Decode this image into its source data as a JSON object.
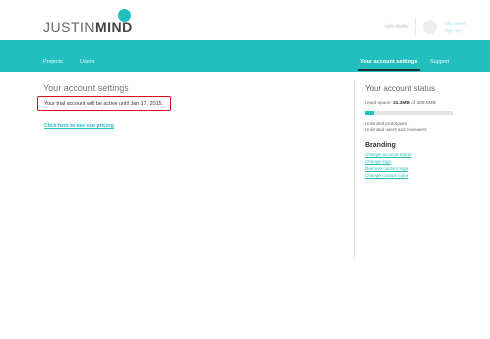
{
  "header": {
    "logo_light": "JUSTIN",
    "logo_bold": "MIND",
    "user_name_blurred": "wilb-studio",
    "user_line1_blurred": "wilb-owner",
    "user_line2_blurred": "Sign out"
  },
  "nav": {
    "projects": "Projects",
    "users": "Users",
    "account_settings": "Your account settings",
    "support": "Support"
  },
  "main": {
    "title": "Your account settings",
    "trial_text": "Your trial account will be active until Jan 17, 2015.",
    "pricing_link": "Click here to see our pricing"
  },
  "sidebar": {
    "status_title": "Your account status",
    "used_space_prefix": "Used space: ",
    "used_space_value": "31.3MB",
    "used_space_suffix": " of 300.0MB",
    "used_space_fraction": 0.104,
    "prototypes": "Unlimited prototypes",
    "users": "Unlimited users and reviewers",
    "branding_title": "Branding",
    "branding_links": [
      "Change account name",
      "Change logo",
      "Remove custom logo",
      "Change custom color"
    ]
  },
  "colors": {
    "accent": "#21bfbd",
    "highlight_box": "#d9111a"
  }
}
